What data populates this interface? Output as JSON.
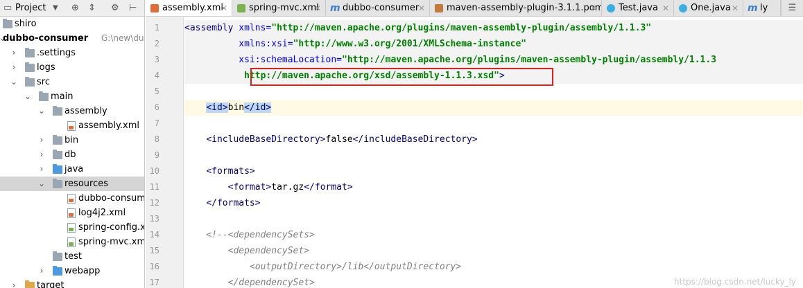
{
  "project_panel": {
    "title": "Project",
    "tree": [
      {
        "label": "shiro"
      },
      {
        "label": "dubbo-consumer",
        "path": "G:\\new\\dub"
      },
      {
        "label": ".settings"
      },
      {
        "label": "logs"
      },
      {
        "label": "src"
      },
      {
        "label": "main"
      },
      {
        "label": "assembly"
      },
      {
        "label": "assembly.xml"
      },
      {
        "label": "bin"
      },
      {
        "label": "db"
      },
      {
        "label": "java"
      },
      {
        "label": "resources"
      },
      {
        "label": "dubbo-consume"
      },
      {
        "label": "log4j2.xml"
      },
      {
        "label": "spring-config.xm"
      },
      {
        "label": "spring-mvc.xml"
      },
      {
        "label": "test"
      },
      {
        "label": "webapp"
      },
      {
        "label": "target"
      }
    ]
  },
  "tabs": [
    {
      "label": "assembly.xml"
    },
    {
      "label": "spring-mvc.xml"
    },
    {
      "label": "dubbo-consumer"
    },
    {
      "label": "maven-assembly-plugin-3.1.1.pom"
    },
    {
      "label": "Test.java"
    },
    {
      "label": "One.java"
    },
    {
      "label": "ly"
    }
  ],
  "editor": {
    "line_numbers": [
      "1",
      "2",
      "3",
      "4",
      "5",
      "6",
      "7",
      "8",
      "9",
      "10",
      "11",
      "12",
      "13",
      "14",
      "15",
      "16",
      "17"
    ],
    "line1": {
      "open": "<assembly",
      "attr1": " xmlns=",
      "val1": "\"http://maven.apache.org/plugins/maven-assembly-plugin/assembly/1.1.3\""
    },
    "line2": {
      "indent": "          ",
      "attr": "xmlns:xsi=",
      "val": "\"http://www.w3.org/2001/XMLSchema-instance\""
    },
    "line3": {
      "indent": "          ",
      "attr": "xsi:schemaLocation=",
      "val": "\"http://maven.apache.org/plugins/maven-assembly-plugin/assembly/1.1.3"
    },
    "line4": {
      "indent": "           ",
      "val": "http://maven.apache.org/xsd/assembly-1.1.3.xsd\"",
      "close": ">"
    },
    "line6": {
      "indent": "    ",
      "open": "<id>",
      "text": "bin",
      "close": "</id>"
    },
    "line8": {
      "indent": "    ",
      "open": "<includeBaseDirectory>",
      "text": "false",
      "close": "</includeBaseDirectory>"
    },
    "line10": {
      "indent": "    ",
      "open": "<formats>"
    },
    "line11": {
      "indent": "        ",
      "open": "<format>",
      "text": "tar.gz",
      "close": "</format>"
    },
    "line12": {
      "indent": "    ",
      "close": "</formats>"
    },
    "line14": {
      "indent": "    ",
      "text": "<!--<dependencySets>"
    },
    "line15": {
      "indent": "        ",
      "text": "<dependencySet>"
    },
    "line16": {
      "indent": "            ",
      "text": "<outputDirectory>/lib</outputDirectory>"
    },
    "line17": {
      "indent": "        ",
      "text": "</dependencySet>"
    }
  },
  "watermark": "https://blog.csdn.net/lucky_ly",
  "colors": {
    "tag": "#000080",
    "attr": "#0000ff",
    "value": "#008000",
    "comment": "#808080",
    "annotation_box": "#e0201b"
  }
}
